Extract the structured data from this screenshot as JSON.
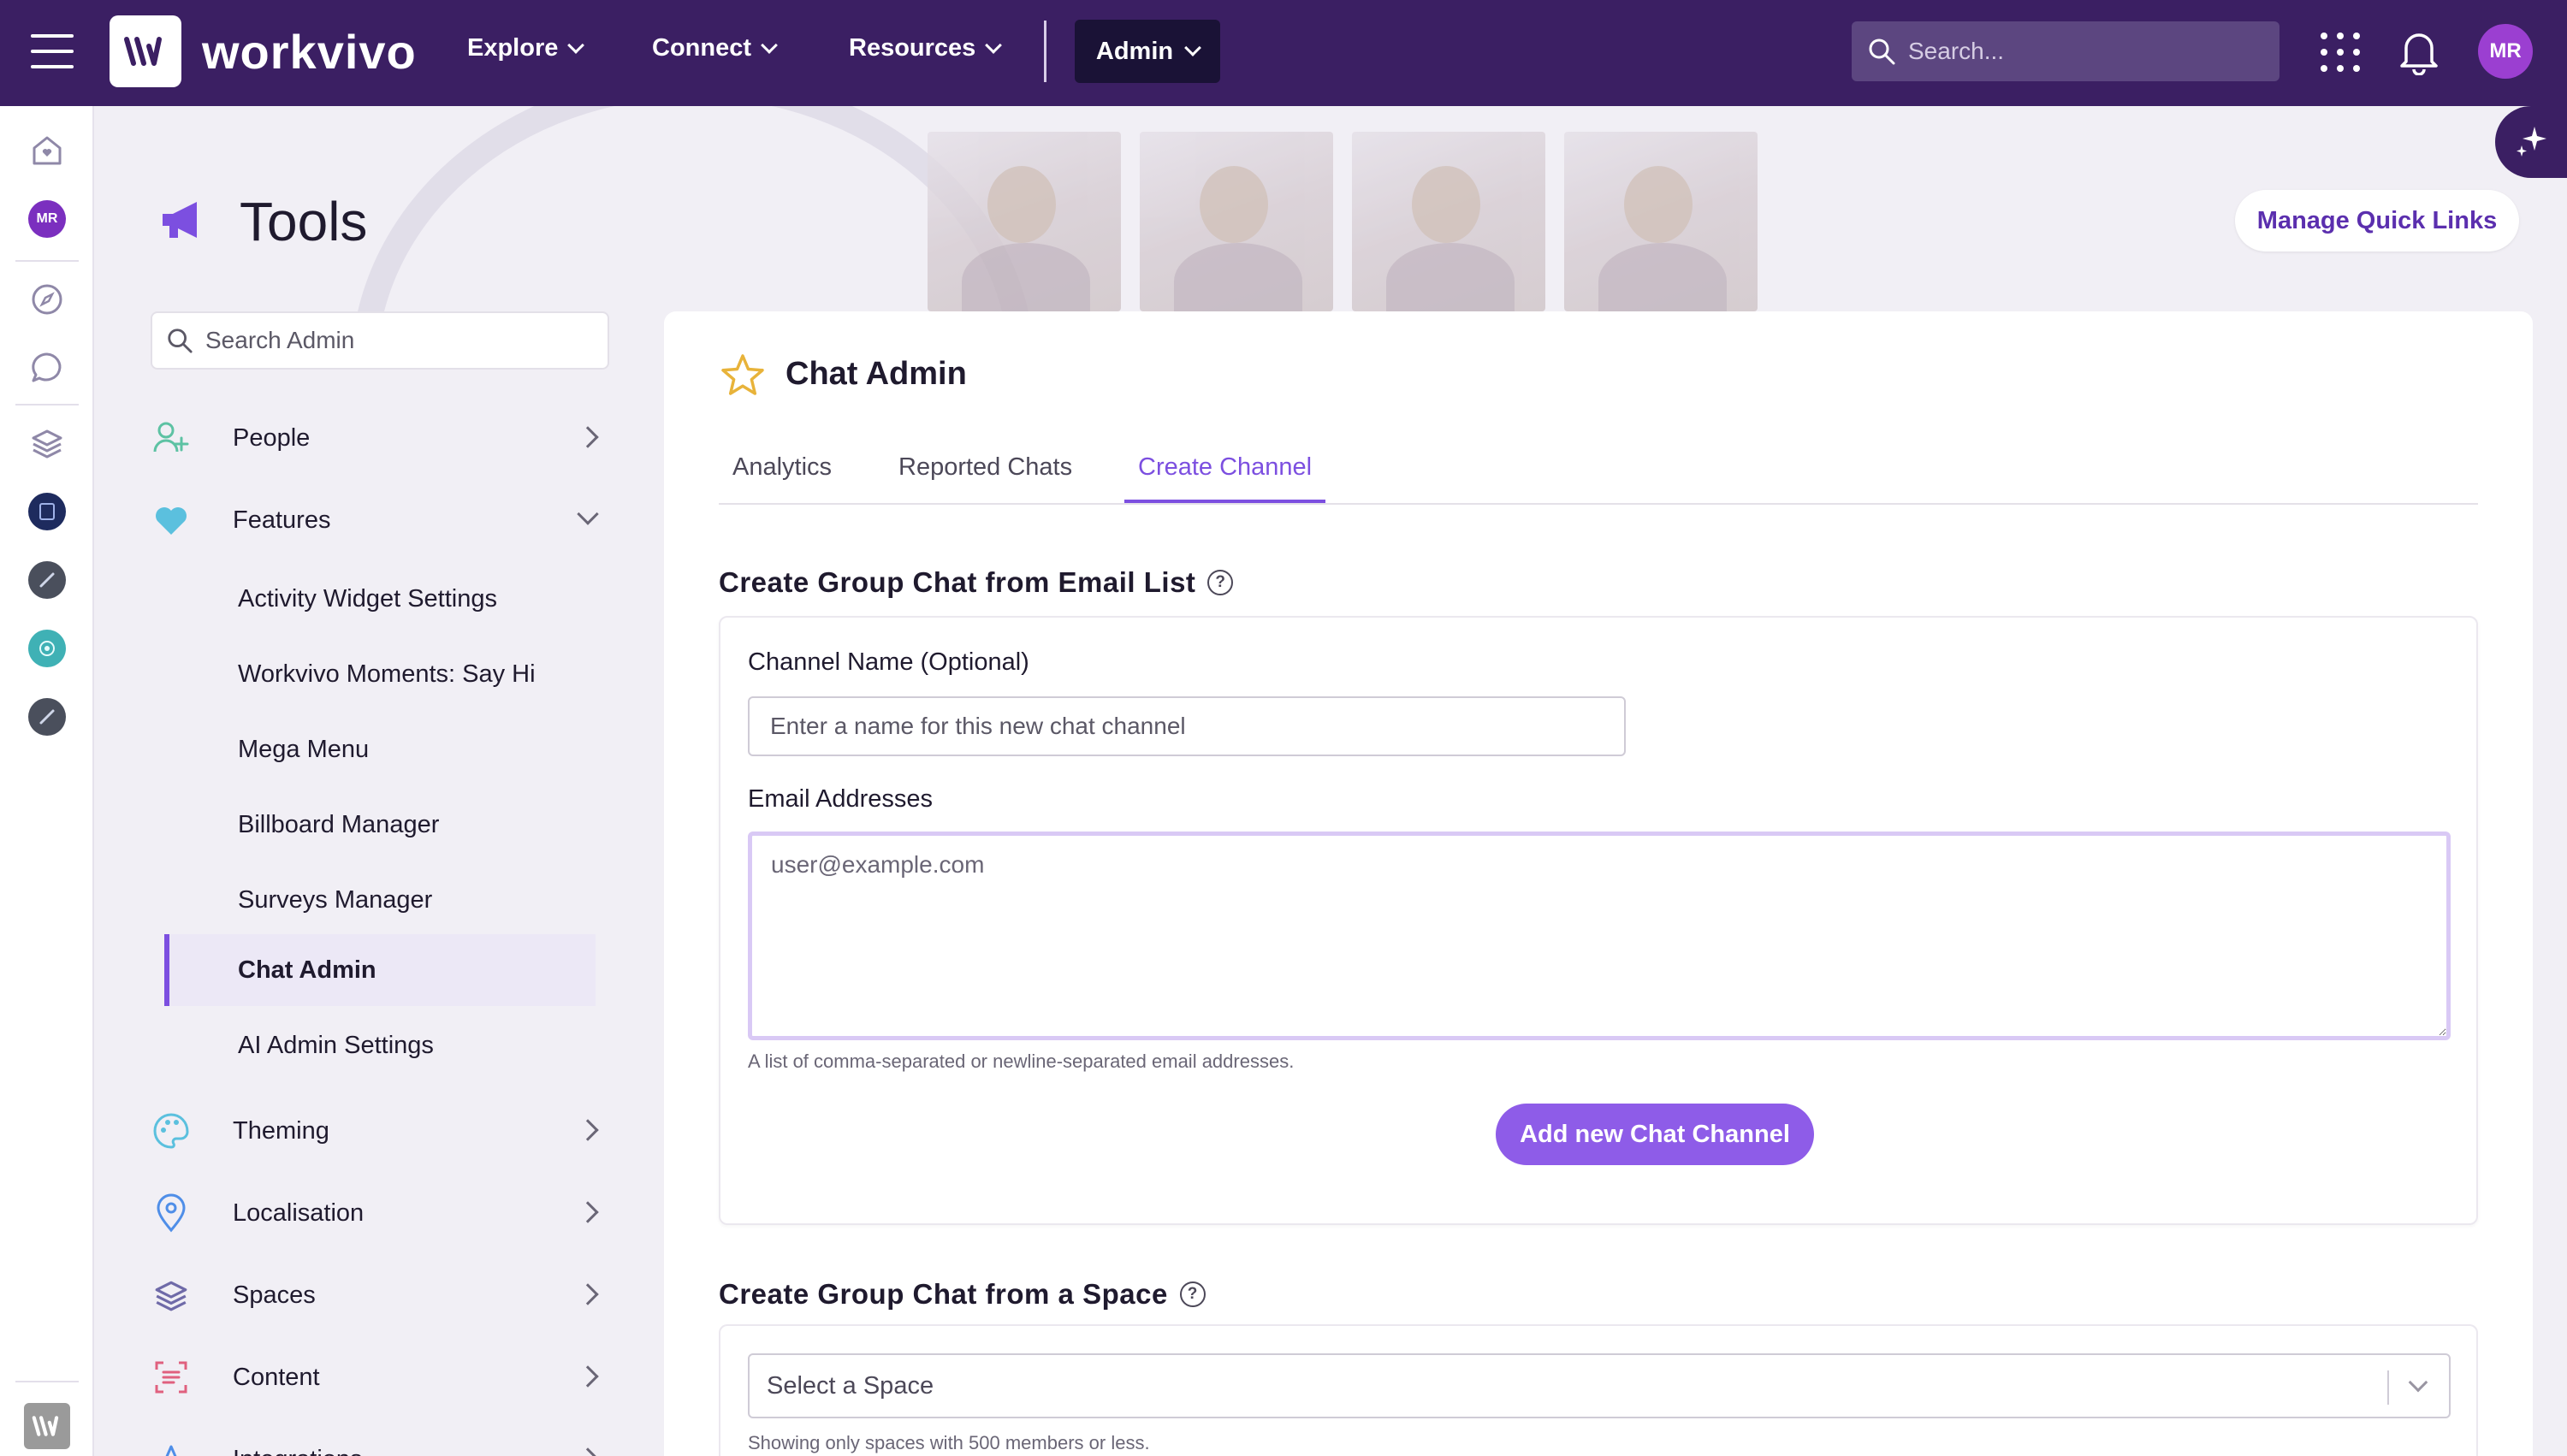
{
  "header": {
    "brand": "workvivo",
    "nav": [
      {
        "label": "Explore"
      },
      {
        "label": "Connect"
      },
      {
        "label": "Resources"
      }
    ],
    "admin_label": "Admin",
    "search_placeholder": "Search...",
    "avatar_initials": "MR"
  },
  "rail": {
    "avatar_initials": "MR"
  },
  "page": {
    "title": "Tools",
    "quick_links_label": "Manage Quick Links"
  },
  "sidebar": {
    "search_placeholder": "Search Admin",
    "sections": [
      {
        "label": "People"
      },
      {
        "label": "Features"
      },
      {
        "label": "Theming"
      },
      {
        "label": "Localisation"
      },
      {
        "label": "Spaces"
      },
      {
        "label": "Content"
      },
      {
        "label": "Integrations"
      }
    ],
    "feature_items": [
      {
        "label": "Activity Widget Settings"
      },
      {
        "label": "Workvivo Moments: Say Hi"
      },
      {
        "label": "Mega Menu"
      },
      {
        "label": "Billboard Manager"
      },
      {
        "label": "Surveys Manager"
      },
      {
        "label": "Chat Admin"
      },
      {
        "label": "AI Admin Settings"
      }
    ]
  },
  "main": {
    "title": "Chat Admin",
    "tabs": [
      {
        "label": "Analytics"
      },
      {
        "label": "Reported Chats"
      },
      {
        "label": "Create Channel"
      }
    ],
    "email_section": {
      "title": "Create Group Chat from Email List",
      "channel_label": "Channel Name (Optional)",
      "channel_placeholder": "Enter a name for this new chat channel",
      "emails_label": "Email Addresses",
      "emails_placeholder": "user@example.com",
      "emails_hint": "A list of comma-separated or newline-separated email addresses.",
      "submit_label": "Add new Chat Channel"
    },
    "space_section": {
      "title": "Create Group Chat from a Space",
      "select_placeholder": "Select a Space",
      "hint": "Showing only spaces with 500 members or less."
    }
  },
  "colors": {
    "topbar": "#3b1f63",
    "accent": "#7c4fe0",
    "button": "#8e5ce8"
  }
}
